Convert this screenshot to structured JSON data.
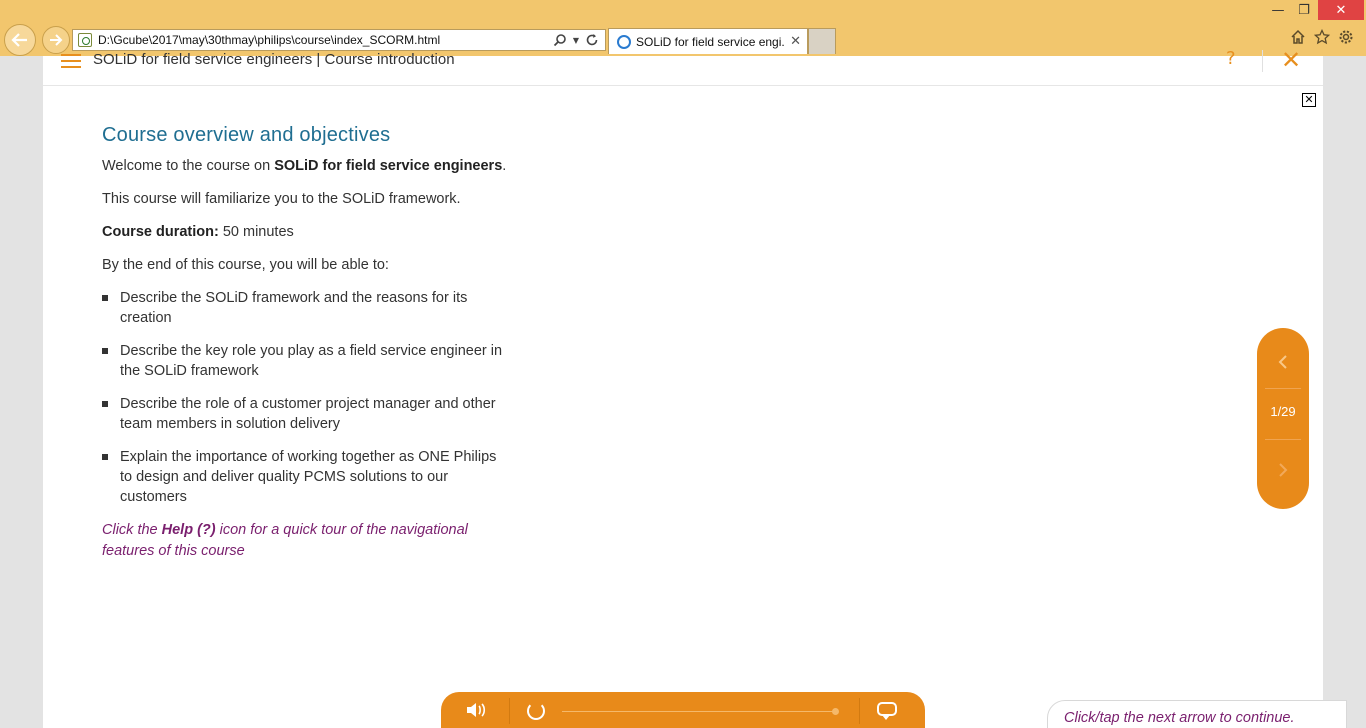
{
  "browser": {
    "url": "D:\\Gcube\\2017\\may\\30thmay\\philips\\course\\index_SCORM.html",
    "tab_title": "SOLiD for field service engi...",
    "icons": {
      "back": "back-arrow-icon",
      "forward": "forward-arrow-icon",
      "search": "search-icon",
      "refresh": "refresh-icon",
      "home": "home-icon",
      "favorites": "star-icon",
      "settings": "gear-icon"
    }
  },
  "course": {
    "header_title": "SOLiD for field service engineers | Course introduction",
    "accent_color": "#e88a1a",
    "heading": "Course overview and objectives",
    "intro_prefix": "Welcome to the course on ",
    "intro_bold": "SOLiD for field service engineers",
    "intro_suffix": ".",
    "familiarize": "This course will familiarize you to the SOLiD framework.",
    "duration_label": "Course duration:",
    "duration_value": " 50 minutes",
    "objectives_intro": "By the end of this course, you will be able to:",
    "objectives": [
      "Describe the SOLiD framework and the reasons for its creation",
      "Describe the key role you play as a field service engineer in the SOLiD framework",
      "Describe the role of a customer project manager and other team members in solution delivery",
      "Explain the importance of working together as ONE Philips to design and deliver quality PCMS solutions to our customers"
    ],
    "help_prefix": "Click the ",
    "help_bold": "Help (?)",
    "help_suffix": " icon for a quick tour of the navigational features of this course",
    "help_symbol": "?",
    "close_symbol": "✕",
    "page_count": "1/29",
    "continue_hint": "Click/tap the next arrow to continue."
  }
}
